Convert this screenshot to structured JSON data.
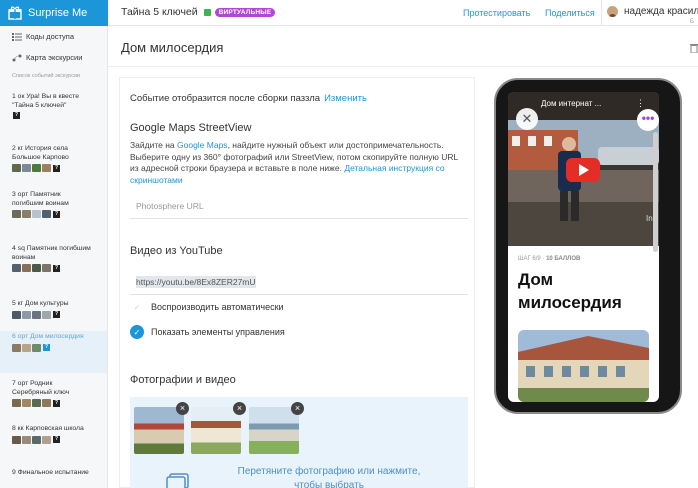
{
  "topbar": {
    "brand": "Surprise Me",
    "quest_title": "Тайна 5 ключей",
    "virtual_badge": "ВИРТУАЛЬНЫЕ",
    "test_link": "Протестировать",
    "share_link": "Поделиться",
    "user_name": "надежда красил",
    "user_sub": "Б"
  },
  "sidebar": {
    "links": [
      {
        "label": "Коды доступа",
        "icon": "list-icon"
      },
      {
        "label": "Карта экскурсии",
        "icon": "map-route-icon"
      }
    ],
    "section_title": "Список событий экскурсии",
    "steps": [
      {
        "text": "1 ок Ура! Вы в квесте \"Тайна 5 ключей\"",
        "badge": "?",
        "active": false
      },
      {
        "text": "2 кг История села Большое Карпово",
        "badge": "?",
        "active": false
      },
      {
        "text": "3 орт Памятник погибшим воинам",
        "badge": "?",
        "active": false
      },
      {
        "text": "4 sq Памятник погибшим воинам",
        "badge": "?",
        "active": false
      },
      {
        "text": "5 кг Дом культуры",
        "badge": "?",
        "active": false
      },
      {
        "text": "6 орт Дом милосердия",
        "badge": "?",
        "active": true
      },
      {
        "text": "7 орт Родник Серебряный ключ",
        "badge": "?",
        "active": false
      },
      {
        "text": "8 кк Карповская школа",
        "badge": "?",
        "active": false
      },
      {
        "text": "9 Финальное испытание",
        "badge": "",
        "active": false
      }
    ]
  },
  "page": {
    "title": "Дом милосердия"
  },
  "editor": {
    "event_note": "Событие отобразится после сборки паззла",
    "change_link": "Изменить",
    "streetview_heading": "Google Maps StreetView",
    "streetview_desc_1": "Зайдите на ",
    "streetview_desc_link": "Google Maps",
    "streetview_desc_2": ", найдите нужный объект или достопримечательность. Выберите одну из 360° фотографий или StreetView, потом скопируйте полную URL из адресной строки браузера и вставьте в поле ниже. ",
    "streetview_desc_link2": "Детальная инструкция со скриншотами",
    "photosphere_placeholder": "Photosphere URL",
    "youtube_heading": "Видео из YouTube",
    "youtube_url": "https://youtu.be/8Ex8ZER27mU",
    "autoplay_label": "Воспроизводить автоматически",
    "autoplay_checked": false,
    "controls_label": "Показать элементы управления",
    "controls_checked": true,
    "photos_heading": "Фотографии и видео",
    "photo_count": 3,
    "upload_text": "Перетяните фотографию или нажмите, чтобы выбрать"
  },
  "preview": {
    "video_title": "Дом интернат ...",
    "video_more": "⋮",
    "video_watermark": "Ind",
    "close_glyph": "✕",
    "more_glyph": "•••",
    "step_meta_prefix": "ШАГ 6/9 · ",
    "step_meta_points": "10 БАЛЛОВ",
    "title": "Дом милосердия"
  },
  "colors": {
    "brand_blue": "#1d96d9",
    "badge_purple": "#b246d6",
    "sidebar_bg": "#f6f7f9",
    "dropzone_bg": "#e8f3fb"
  }
}
